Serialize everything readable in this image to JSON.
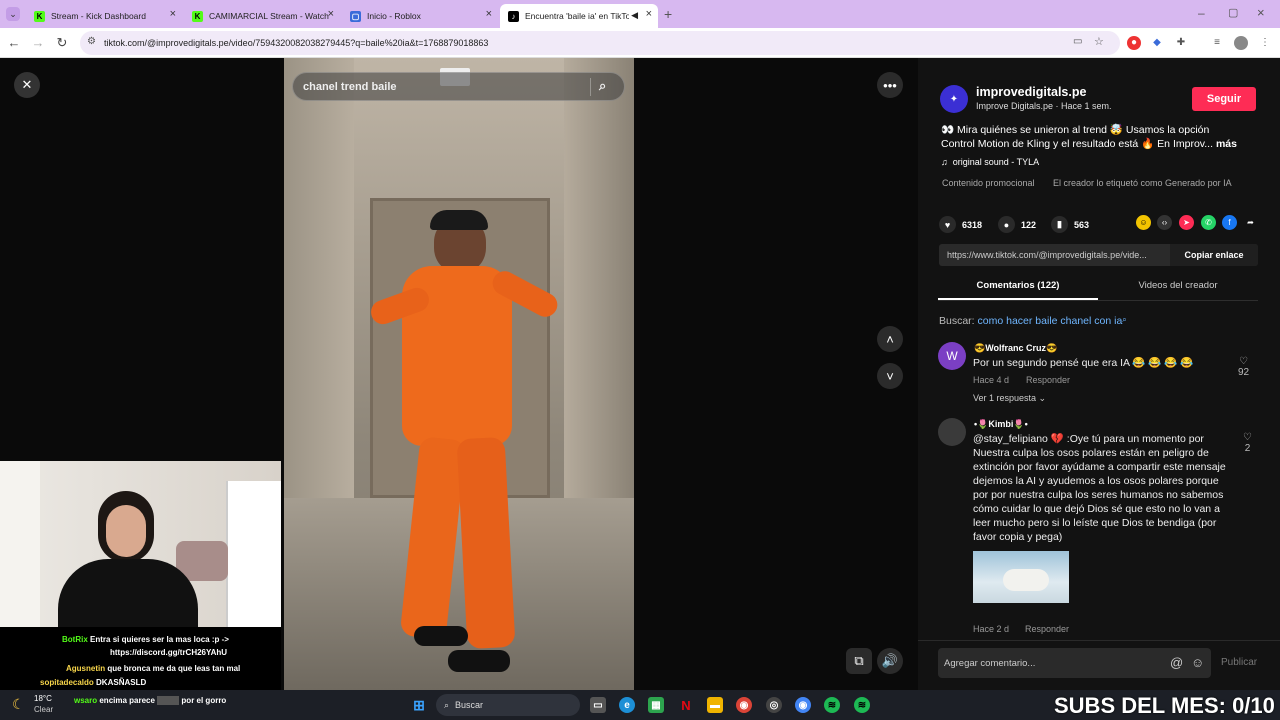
{
  "tabs": [
    {
      "label": "Stream - Kick Dashboard",
      "icon": "kick-icon",
      "color": "#53fc18"
    },
    {
      "label": "CAMIMARCIAL Stream - Watch",
      "icon": "kick-icon",
      "color": "#53fc18"
    },
    {
      "label": "Inicio - Roblox",
      "icon": "roblox-icon",
      "color": "#3a6bd9"
    },
    {
      "label": "Encuentra 'baile ia' en TikTo",
      "icon": "tiktok-icon",
      "color": "#000000"
    }
  ],
  "browser": {
    "url": "tiktok.com/@improvedigitals.pe/video/7594320082038279445?q=baile%20ia&t=1768879018863"
  },
  "video": {
    "search_text": "chanel trend baile"
  },
  "author": {
    "handle": "improvedigitals.pe",
    "subtitle": "Improve Digitals.pe · Hace 1 sem.",
    "follow_label": "Seguir"
  },
  "description": {
    "line1": "👀 Mira quiénes se unieron al trend 🤯 Usamos la opción",
    "line2": "Control Motion de Kling y el resultado está 🔥 En Improv...",
    "more": "más",
    "sound": "original sound - TYLA",
    "promo": "Contenido promocional",
    "ai_label": "El creador lo etiquetó como Generado por IA"
  },
  "stats": {
    "likes": "6318",
    "comments": "122",
    "saves": "563"
  },
  "share": {
    "link": "https://www.tiktok.com/@improvedigitals.pe/vide...",
    "copy_label": "Copiar enlace"
  },
  "panel_tabs": {
    "comments": "Comentarios (122)",
    "creator_videos": "Videos del creador"
  },
  "search_suggest": {
    "prefix": "Buscar:",
    "query": "como hacer baile chanel con ia"
  },
  "comments": [
    {
      "initial": "W",
      "name": "😎Wolfranc Cruz😎",
      "text": "Por un segundo pensé que era IA 😂 😂 😂 😂",
      "time": "Hace 4 d",
      "reply": "Responder",
      "likes": "92",
      "replies": "Ver 1 respuesta"
    },
    {
      "name": "•🌷Kimbi🌷•",
      "text": "@stay_felipiano 💔 :Oye tú para un momento por Nuestra culpa los osos polares están en peligro de extinción por favor ayúdame a compartir este mensaje dejemos la AI y ayudemos a los osos polares porque por por nuestra culpa los seres humanos no sabemos cómo cuidar lo que dejó Dios sé que esto no lo van a leer mucho pero si lo leíste que Dios te bendiga (por favor copia y pega)",
      "time": "Hace 2 d",
      "reply": "Responder",
      "likes": "2"
    }
  ],
  "add_comment": {
    "placeholder": "Agregar comentario...",
    "post_label": "Publicar"
  },
  "chat": [
    {
      "user": "BotRix",
      "text": "Entra si quieres ser la mas loca :p ->",
      "color": "#53fc18"
    },
    {
      "user": "",
      "text": "https://discord.gg/trCH26YAhU",
      "color": "#ffffff"
    },
    {
      "user": "Agusnetin",
      "text": "que bronca me da que leas tan mal",
      "color": "#f7d54a"
    },
    {
      "user": "sopitadecaldo",
      "text": "DKASÑASLD",
      "color": "#f7d54a"
    },
    {
      "user": "wsaro",
      "text": "encima parece",
      "text2": "por el gorro",
      "color": "#53fc18"
    }
  ],
  "weather": {
    "temp": "18°C",
    "cond": "Clear"
  },
  "taskbar": {
    "search": "Buscar"
  },
  "overlay": {
    "subs_banner": "SUBS DEL MES: 0/10"
  }
}
